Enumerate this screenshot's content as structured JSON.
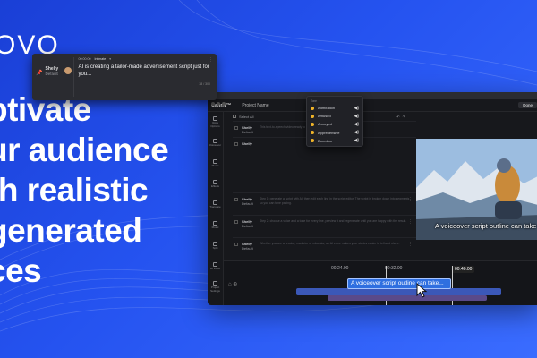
{
  "brand": {
    "logo": "OVO"
  },
  "headline": "ptivate\nur audience\nth realistic\ngenerated\nces",
  "app": {
    "brand": "Canny™",
    "project": "Project Name",
    "done": "Done",
    "select_all": "Select All",
    "sidebar": [
      "Voice Options",
      "Voiceover",
      "Music",
      "Effects",
      "Translate",
      "Music",
      "Split",
      "AI Voice",
      "Project Settings"
    ],
    "rows": [
      {
        "name": "Shelly",
        "role": "Default",
        "text": "This text-to-speech video ready to ..."
      },
      {
        "name": "Shelly",
        "role": "Default",
        "text": ""
      },
      {
        "name": "Shelly",
        "role": "Default",
        "text": "Step 1: generate a script with AI, then edit each line in the script editor. The script is broken down into segments so you can tune pacing."
      },
      {
        "name": "Shelly",
        "role": "Default",
        "text": "Step 2: choose a voice and a tone for every line, preview it and regenerate until you are happy with the result."
      },
      {
        "name": "Shelly",
        "role": "Default",
        "text": "Whether you are a creator, marketer or educator, an AI voice makes your stories easier to tell and share."
      },
      {
        "name": "Shelly",
        "role": "Default",
        "text": "In the workspace, you can edit the voice per line, change the pacing, add pauses and export a polished voiceover for any video project."
      }
    ],
    "active": {
      "name": "Shelly",
      "role": "Default",
      "time": "00:00:00",
      "tone": "Intimate",
      "script": "AI is creating a tailor-made advertisement script just for you...",
      "count": "38 / 300"
    },
    "tone_menu": {
      "header": "Tone",
      "items": [
        "Admiration",
        "Amused",
        "Annoyed",
        "Apprehensive",
        "Boredom"
      ]
    },
    "preview_caption": "A voiceover script outline can take",
    "timeline": {
      "times": [
        "00:24.00",
        "00:32.00",
        "00:40.00"
      ],
      "caption_clip": "A voiceover script outline can take..."
    }
  },
  "colors": {
    "accent": "#2553f0",
    "tone_dot": "#f0b429"
  }
}
